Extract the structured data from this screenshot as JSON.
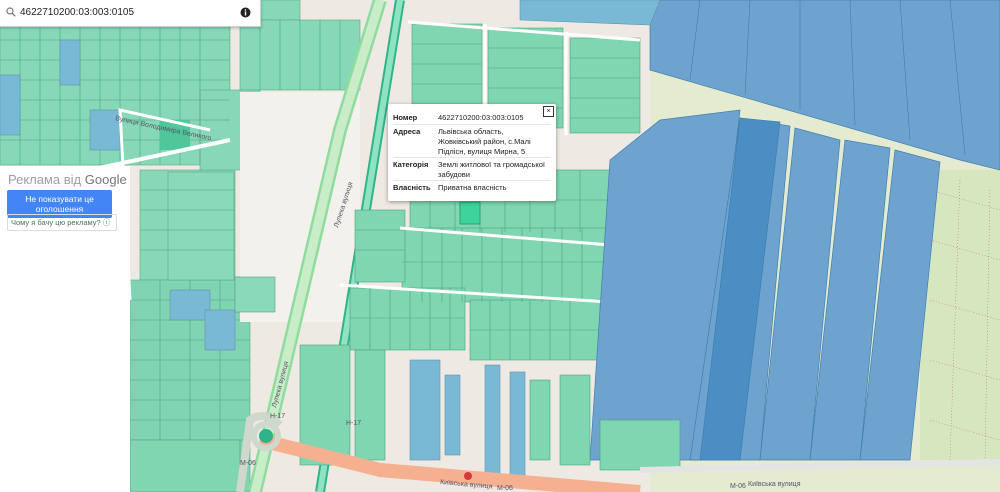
{
  "search": {
    "value": "4622710200:03:003:0105",
    "icon": "search-icon",
    "info_icon": "info-icon"
  },
  "ad": {
    "header_prefix": "Реклама від",
    "header_brand": "Google",
    "stop_button": "Не показувати це оголошення",
    "why_link": "Чому я бачу цю рекламу? ⓘ"
  },
  "popup": {
    "rows": [
      {
        "key": "Номер",
        "value": "4622710200:03:003:0105"
      },
      {
        "key": "Адреса",
        "value": "Львівська область, Жовківський район, с.Малі Підлісн, вулиця Мирна, 5"
      },
      {
        "key": "Категорія",
        "value": "Землі житлової та громадської забудови"
      },
      {
        "key": "Власність",
        "value": "Приватна власність"
      }
    ],
    "close_label": "×"
  },
  "map_labels": {
    "street_1": "Вулиця Володимира Великого",
    "street_2": "Лупека вулиця",
    "street_3": "Лупека вулиця",
    "street_4": "Київська вулиця",
    "street_5": "Київська вулиця",
    "road_h17a": "H-17",
    "road_h17b": "H-17",
    "road_m06a": "M-06",
    "road_m06b": "M-06",
    "road_m06c": "M-06"
  },
  "colors": {
    "parcel_green": "#7fd6b0",
    "parcel_blue": "#7ab9d6",
    "parcel_selected": "#3dd39a",
    "water": "#6fa3cf",
    "road_main": "#f5b090"
  }
}
